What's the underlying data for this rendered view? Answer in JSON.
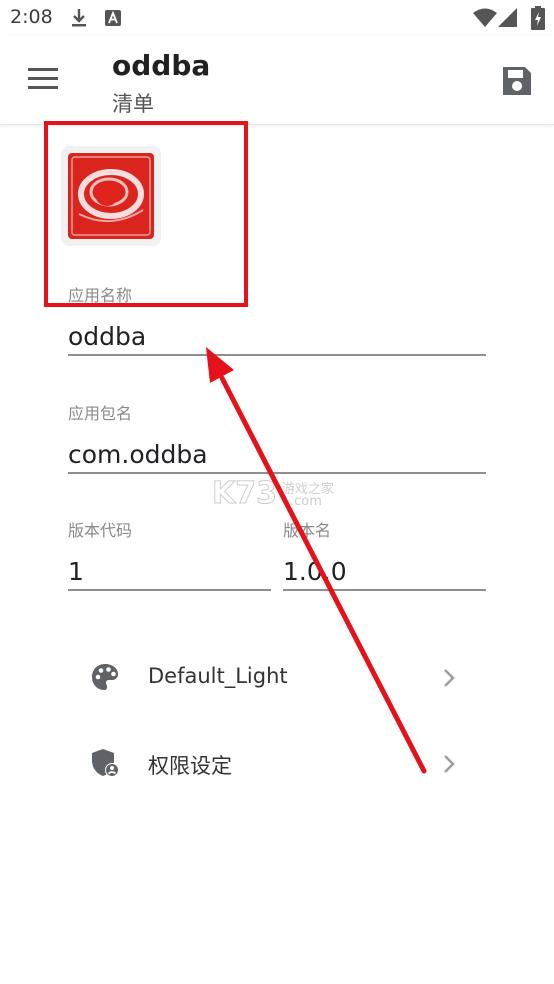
{
  "status_bar": {
    "time": "2:08",
    "icons": [
      "download-icon",
      "a-badge-icon",
      "wifi-icon",
      "signal-icon",
      "battery-icon"
    ]
  },
  "app_bar": {
    "title": "oddba",
    "subtitle": "清单",
    "menu_icon": "menu-icon",
    "save_icon": "save-icon"
  },
  "form": {
    "app_name_label": "应用名称",
    "app_name_value": "oddba",
    "package_label": "应用包名",
    "package_value": "com.oddba",
    "version_code_label": "版本代码",
    "version_code_value": "1",
    "version_name_label": "版本名",
    "version_name_value": "1.0.0"
  },
  "list": {
    "items": [
      {
        "label": "Default_Light",
        "icon": "palette-icon"
      },
      {
        "label": "权限设定",
        "icon": "shield-user-icon"
      }
    ]
  },
  "watermark": {
    "brand": "K73",
    "text_cn": "游戏之家",
    "text_en": ".com"
  },
  "colors": {
    "highlight": "#e5121b",
    "arrow": "#e5121b",
    "icon_red": "#d9251d"
  }
}
